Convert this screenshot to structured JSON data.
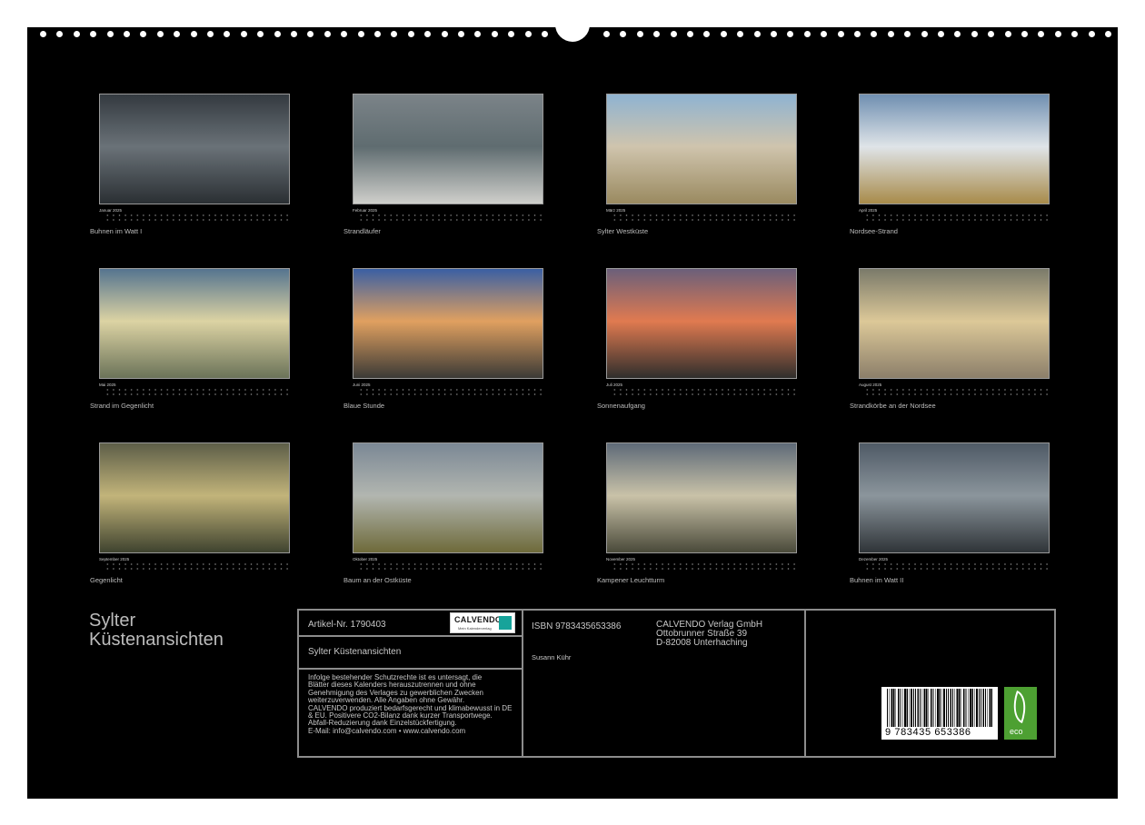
{
  "months": [
    {
      "name": "Januar 2025",
      "caption": "Buhnen im Watt I",
      "colors": [
        "#343a40",
        "#6a7278",
        "#2a2f33"
      ]
    },
    {
      "name": "Februar 2025",
      "caption": "Strandläufer",
      "colors": [
        "#7b8388",
        "#5f6c70",
        "#cfcfcb"
      ]
    },
    {
      "name": "März 2025",
      "caption": "Sylter Westküste",
      "colors": [
        "#8fb3d1",
        "#cfc4ad",
        "#9a8a60"
      ]
    },
    {
      "name": "April 2025",
      "caption": "Nordsee-Strand",
      "colors": [
        "#6f8fb1",
        "#dfe4e8",
        "#a88b4a"
      ]
    },
    {
      "name": "Mai 2025",
      "caption": "Strand im Gegenlicht",
      "colors": [
        "#55748f",
        "#dcd3a3",
        "#6b7359"
      ]
    },
    {
      "name": "Juni 2025",
      "caption": "Blaue Stunde",
      "colors": [
        "#3a5fa3",
        "#e0a060",
        "#3b3a36"
      ]
    },
    {
      "name": "Juli 2025",
      "caption": "Sonnenaufgang",
      "colors": [
        "#6b5f7a",
        "#e07a50",
        "#2f2e2c"
      ]
    },
    {
      "name": "August 2025",
      "caption": "Strandkörbe an der Nordsee",
      "colors": [
        "#7a7a6a",
        "#dcc898",
        "#8c7f6a"
      ]
    },
    {
      "name": "September 2025",
      "caption": "Gegenlicht",
      "colors": [
        "#5d5e48",
        "#c2b47a",
        "#3f432f"
      ]
    },
    {
      "name": "Oktober 2025",
      "caption": "Baum an der Ostküste",
      "colors": [
        "#7b8895",
        "#b2b6b0",
        "#6e6a3a"
      ]
    },
    {
      "name": "November 2025",
      "caption": "Kampener Leuchtturm",
      "colors": [
        "#5e6a78",
        "#c9c2a8",
        "#4a4a3a"
      ]
    },
    {
      "name": "Dezember 2025",
      "caption": "Buhnen im Watt II",
      "colors": [
        "#4f5a66",
        "#8b959c",
        "#2f3438"
      ]
    }
  ],
  "title_line1": "Sylter",
  "title_line2": "Küstenansichten",
  "imprint": {
    "article": "Artikel-Nr. 1790403",
    "logo_text": "CALVENDO",
    "logo_sub": "Mein Kalenderverlag",
    "product_title": "Sylter Küstenansichten",
    "legal_lines": [
      "Infolge bestehender Schutzrechte ist es untersagt, die",
      "Blätter dieses Kalenders herauszutrennen und ohne",
      "Genehmigung des Verlages zu gewerblichen Zwecken",
      "weiterzuverwenden. Alle Angaben ohne Gewähr.",
      "CALVENDO produziert bedarfsgerecht und klimabewusst in DE",
      "& EU. Positivere CO2-Bilanz dank kurzer Transportwege.",
      "Abfall-Reduzierung dank Einzelstückfertigung.",
      "E-Mail: info@calvendo.com • www.calvendo.com"
    ],
    "isbn": "ISBN 9783435653386",
    "author": "Susann Kühr",
    "publisher_lines": [
      "CALVENDO Verlag GmbH",
      "Ottobrunner Straße 39",
      "D-82008 Unterhaching"
    ],
    "barcode_digits": "9 783435 653386",
    "eco_label": "eco"
  }
}
